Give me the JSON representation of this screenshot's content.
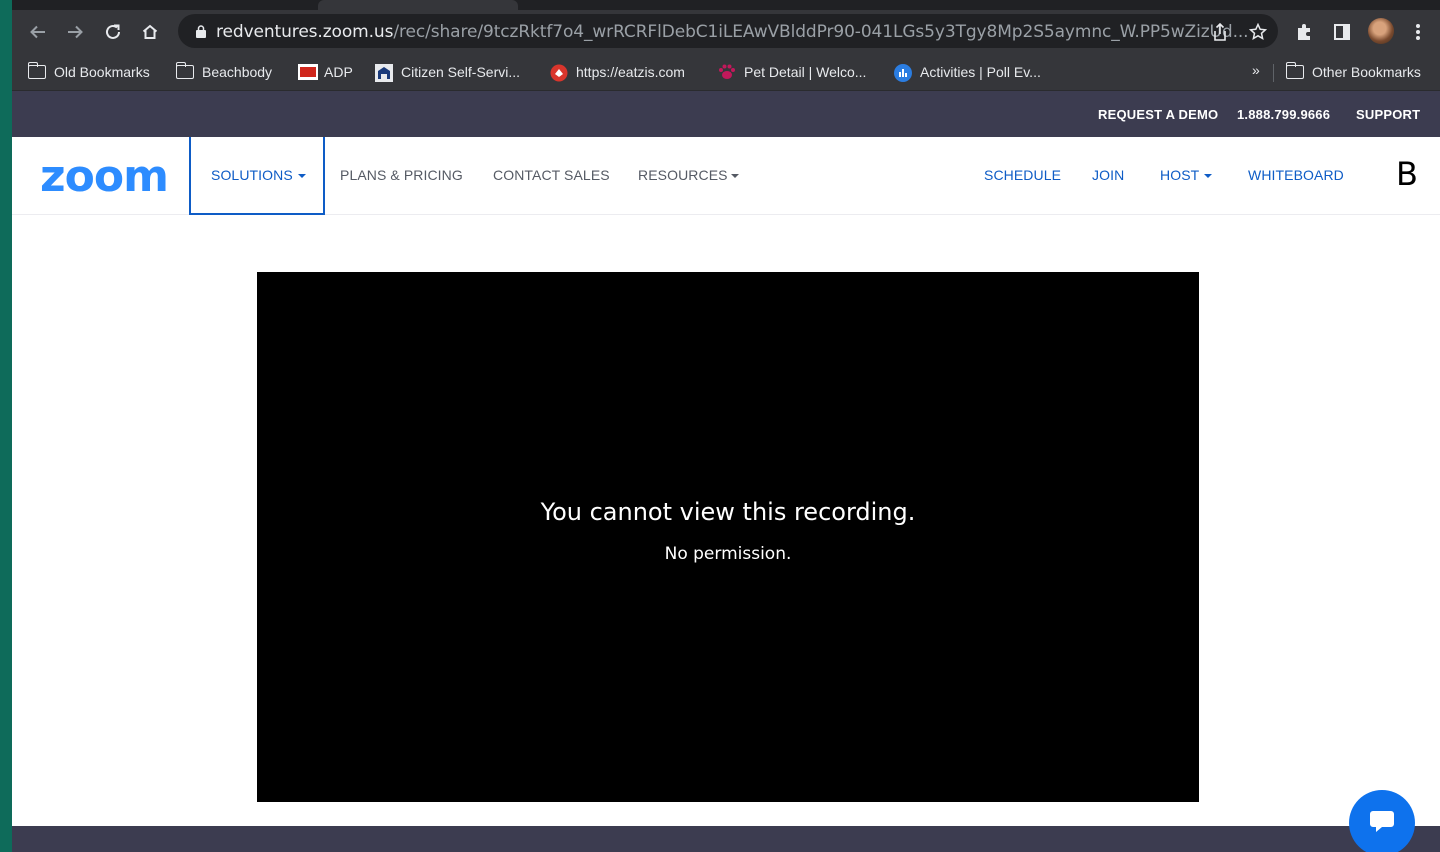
{
  "browser": {
    "url_host": "redventures.zoom.us",
    "url_path": "/rec/share/9tczRktf7o4_wrRCRFlDebC1iLEAwVBlddPr90-041LGs5y3Tgy8Mp2S5aymnc_W.PP5wZizUd...",
    "bookmarks": [
      {
        "label": "Old Bookmarks",
        "icon": "folder-icon"
      },
      {
        "label": "Beachbody",
        "icon": "folder-icon"
      },
      {
        "label": "ADP",
        "icon": "adp-icon"
      },
      {
        "label": "Citizen Self-Servi...",
        "icon": "citizen-icon"
      },
      {
        "label": "https://eatzis.com",
        "icon": "eatzis-icon"
      },
      {
        "label": "Pet Detail | Welco...",
        "icon": "paw-icon"
      },
      {
        "label": "Activities | Poll Ev...",
        "icon": "poll-icon"
      }
    ],
    "overflow_label": "»",
    "other_bookmarks": "Other Bookmarks"
  },
  "utility": {
    "request_demo": "REQUEST A DEMO",
    "phone": "1.888.799.9666",
    "support": "SUPPORT"
  },
  "nav": {
    "logo": "zoom",
    "solutions": "SOLUTIONS",
    "plans": "PLANS & PRICING",
    "contact": "CONTACT SALES",
    "resources": "RESOURCES",
    "schedule": "SCHEDULE",
    "join": "JOIN",
    "host": "HOST",
    "whiteboard": "WHITEBOARD",
    "account_initial": "B"
  },
  "player": {
    "title": "You cannot view this recording.",
    "subtitle": "No permission."
  },
  "colors": {
    "accent": "#0e5cc6",
    "logo": "#2d8cff",
    "utility_bar": "#3c3c50",
    "chat_button": "#0e72ed"
  }
}
